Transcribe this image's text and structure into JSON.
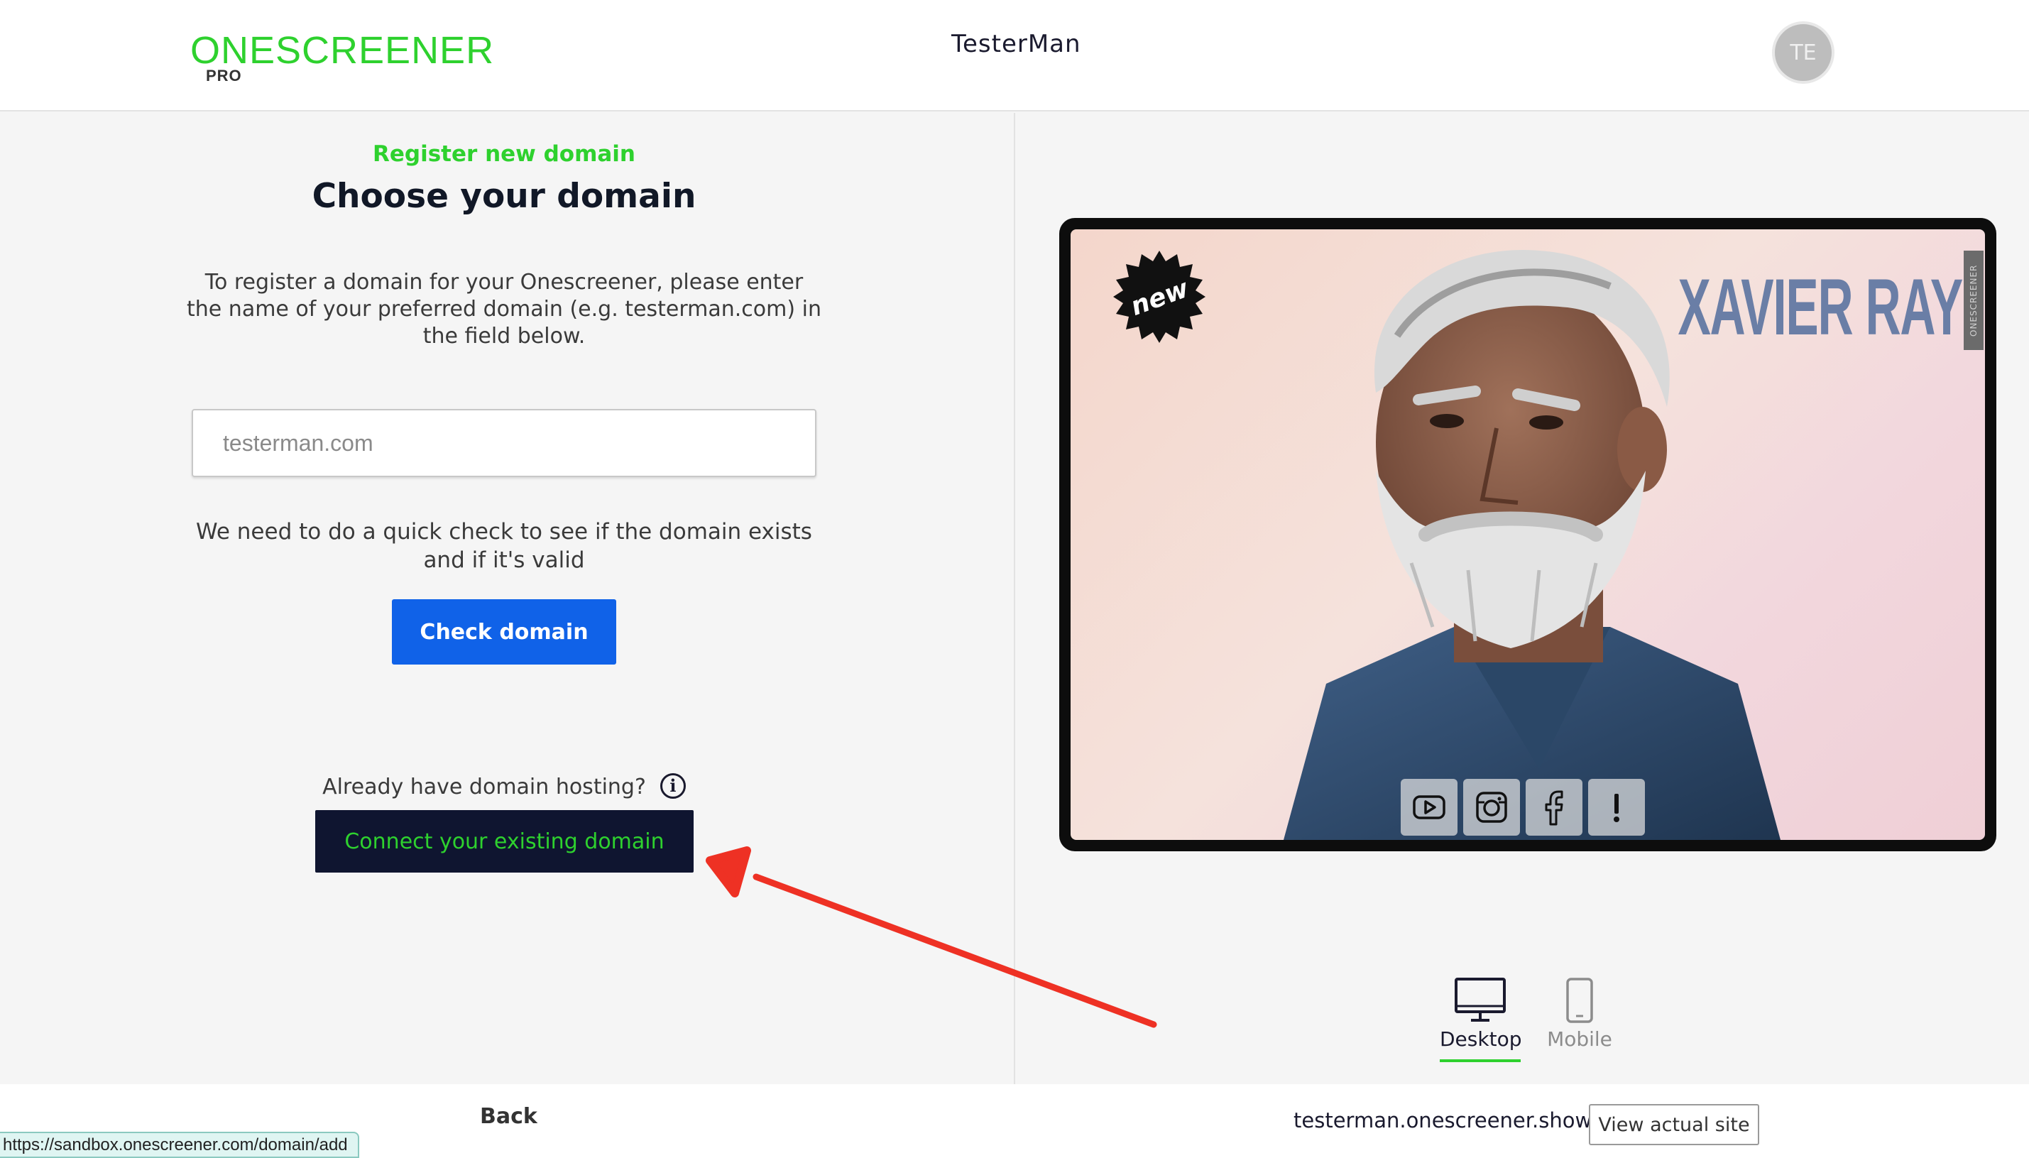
{
  "header": {
    "logo": "ONESCREENER",
    "logo_sub": "PRO",
    "title": "TesterMan",
    "avatar_initials": "TE"
  },
  "register": {
    "kicker": "Register new domain",
    "title": "Choose your domain",
    "description": "To register a domain for your Onescreener, please enter the name of your preferred domain (e.g. testerman.com) in the field below.",
    "input_placeholder": "testerman.com",
    "check_note": "We need to do a quick check to see if the domain exists and if it's valid",
    "check_button": "Check domain",
    "hosting_question": "Already have domain hosting?",
    "connect_button": "Connect your existing domain"
  },
  "preview": {
    "artist_name": "XAVIER RAY",
    "badge_text": "new",
    "side_label": "ONESCREENER",
    "social_icons": [
      "youtube-icon",
      "instagram-icon",
      "facebook-icon",
      "alert-icon"
    ],
    "view_modes": [
      {
        "label": "Desktop",
        "icon": "desktop-icon",
        "active": true
      },
      {
        "label": "Mobile",
        "icon": "mobile-icon",
        "active": false
      }
    ]
  },
  "footer": {
    "back": "Back",
    "site_url": "testerman.onescreener.show",
    "view_site_button": "View actual site"
  },
  "status_bar": {
    "url": "https://sandbox.onescreener.com/domain/add"
  },
  "colors": {
    "accent_green": "#2ed12e",
    "primary_blue": "#1062e8",
    "dark_navy": "#0f1530",
    "annotation_red": "#ee3124"
  }
}
